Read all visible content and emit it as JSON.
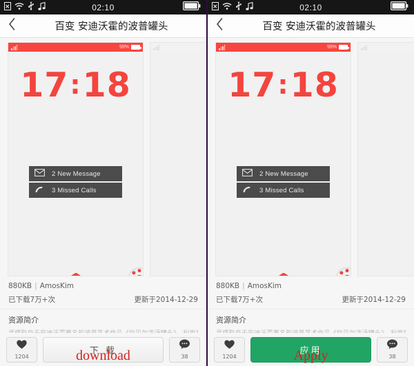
{
  "statusbar": {
    "time": "02:10",
    "icons": [
      "sim-card-icon",
      "wifi-icon",
      "usb-icon",
      "music-note-icon"
    ],
    "battery_icon": "battery-full-icon",
    "bg_color": "#161616"
  },
  "navbar": {
    "back_icon": "chevron-left-icon",
    "title": "百变 安迪沃霍的波普罐头"
  },
  "preview": {
    "status": {
      "signal_icon": "signal-bars-icon",
      "battery_percent": "99%",
      "battery_icon": "battery-icon",
      "bar_color": "#f9453f"
    },
    "clock": {
      "hours": "17",
      "separator": ":",
      "minutes": "18",
      "color": "#f4443e"
    },
    "notifications": [
      {
        "icon": "envelope-icon",
        "count": "2",
        "label": "New Message"
      },
      {
        "icon": "phone-handset-icon",
        "count": "3",
        "label": "Missed Calls"
      }
    ],
    "chevron_up_icon": "chevron-up-icon",
    "dial_icon": "rotary-dial-icon",
    "message_icon": "speech-bubble-icon"
  },
  "info": {
    "size": "880KB",
    "separator": "|",
    "author": "AmosKim",
    "downloads": "已下载7万+次",
    "updated": "更新于2014-12-29"
  },
  "description": {
    "title": "资源简介",
    "body": "灵感取自于安迪沃霍著名的波普艺术作品《坎贝尔浓汤罐头》，利用甘简洁"
  },
  "actions": {
    "like": {
      "icon": "heart-icon",
      "count": "1204"
    },
    "comment": {
      "icon": "comment-bubble-icon",
      "count": "38"
    },
    "left_panel_button": {
      "label": "下 载",
      "annotation": "download",
      "style": "grey"
    },
    "right_panel_button": {
      "label": "应用",
      "annotation": "Apply",
      "style": "green",
      "color": "#21a565"
    }
  }
}
